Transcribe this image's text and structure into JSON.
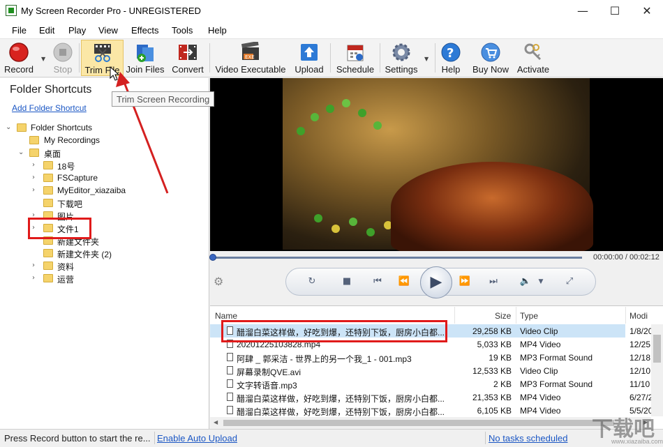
{
  "window": {
    "title": "My Screen Recorder Pro - UNREGISTERED"
  },
  "menu": [
    "File",
    "Edit",
    "Play",
    "View",
    "Effects",
    "Tools",
    "Help"
  ],
  "toolbar": {
    "record": "Record",
    "stop": "Stop",
    "trim": "Trim File",
    "join": "Join Files",
    "convert": "Convert",
    "video_exe": "Video Executable",
    "upload": "Upload",
    "schedule": "Schedule",
    "settings": "Settings",
    "help": "Help",
    "buy": "Buy Now",
    "activate": "Activate"
  },
  "tooltip": "Trim Screen Recording",
  "left": {
    "title": "Folder Shortcuts",
    "add_link": "Add Folder Shortcut",
    "tree": [
      "Folder Shortcuts",
      "My Recordings",
      "桌面",
      "18号",
      "FSCapture",
      "MyEditor_xiazaiba",
      "下载吧",
      "图片",
      "文件1",
      "新建文件夹",
      "新建文件夹 (2)",
      "资料",
      "运营"
    ]
  },
  "player": {
    "time": "00:00:00 / 00:02:12"
  },
  "files": {
    "headers": {
      "name": "Name",
      "size": "Size",
      "type": "Type",
      "modified": "Modi"
    },
    "rows": [
      {
        "name": "醋溜白菜这样做，好吃到爆，还特别下饭，厨房小白都...",
        "size": "29,258 KB",
        "type": "Video Clip",
        "mod": "1/8/20"
      },
      {
        "name": "20201225103828.mp4",
        "size": "5,033 KB",
        "type": "MP4 Video",
        "mod": "12/25"
      },
      {
        "name": "阿肆 _ 郭采洁 - 世界上的另一个我_1 - 001.mp3",
        "size": "19 KB",
        "type": "MP3 Format Sound",
        "mod": "12/18"
      },
      {
        "name": "屏幕录制QVE.avi",
        "size": "12,533 KB",
        "type": "Video Clip",
        "mod": "12/10"
      },
      {
        "name": "文字转语音.mp3",
        "size": "2 KB",
        "type": "MP3 Format Sound",
        "mod": "11/10"
      },
      {
        "name": "醋溜白菜这样做，好吃到爆，还特别下饭，厨房小白都...",
        "size": "21,353 KB",
        "type": "MP4 Video",
        "mod": "6/27/2"
      },
      {
        "name": "醋溜白菜这样做，好吃到爆，还特别下饭，厨房小白都...",
        "size": "6,105 KB",
        "type": "MP4 Video",
        "mod": "5/5/20"
      }
    ]
  },
  "status": {
    "text": "Press Record button to start the re...",
    "auto_upload": "Enable Auto Upload",
    "tasks": "No tasks scheduled"
  },
  "watermark": {
    "main": "下载吧",
    "sub": "www.xiazaiba.com"
  },
  "colors": {
    "highlight_red": "#e01a1a",
    "link_blue": "#1a56c4",
    "selection": "#cce4f7",
    "folder": "#f5d36b"
  }
}
